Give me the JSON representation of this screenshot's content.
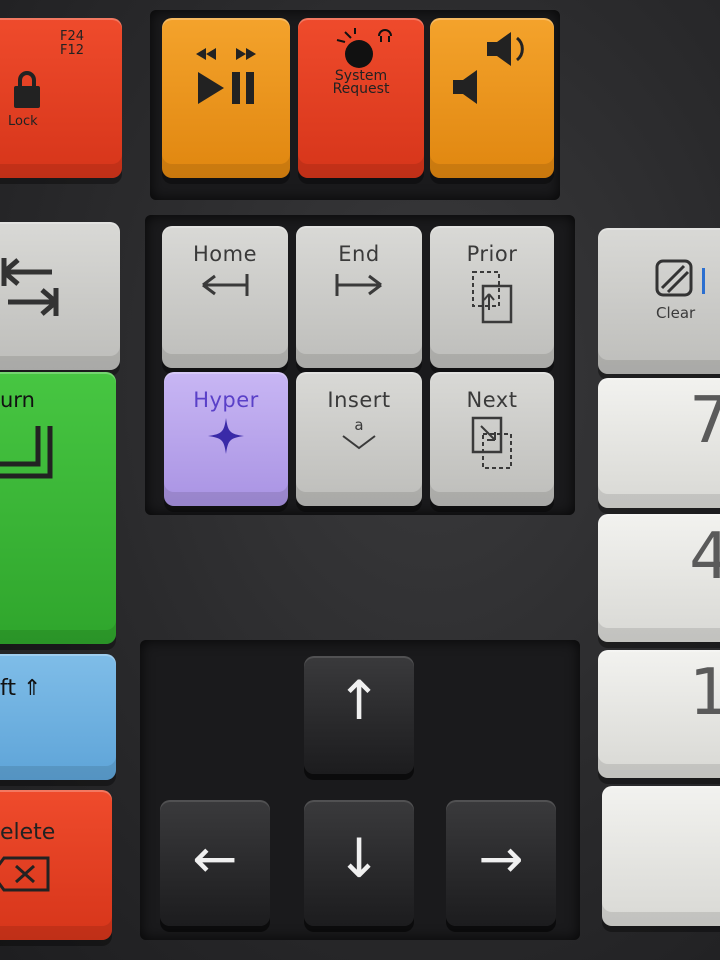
{
  "keys": {
    "lock": {
      "f_top": "F24",
      "f_bottom": "F12",
      "label": "Lock"
    },
    "media_play": {
      "icon": "play-pause-icon"
    },
    "system_request": {
      "line1": "System",
      "line2": "Request"
    },
    "volume": {
      "icon": "volume-icon"
    },
    "tab": {
      "icon": "tab-arrows-icon"
    },
    "home": {
      "label": "Home",
      "icon": "arrow-left-bar-icon"
    },
    "end": {
      "label": "End",
      "icon": "arrow-right-bar-icon"
    },
    "prior": {
      "label": "Prior",
      "icon": "page-up-icon"
    },
    "clear": {
      "label": "Clear"
    },
    "return": {
      "label": "urn"
    },
    "hyper": {
      "label": "Hyper",
      "icon": "sparkle-icon"
    },
    "insert": {
      "label": "Insert",
      "sub": "a"
    },
    "next": {
      "label": "Next",
      "icon": "page-down-icon"
    },
    "seven": {
      "label": "7"
    },
    "four": {
      "label": "4"
    },
    "one": {
      "label": "1"
    },
    "shift": {
      "label": "ft ⇑"
    },
    "delete": {
      "label": "elete"
    },
    "up": {
      "glyph": "↑"
    },
    "left": {
      "glyph": "←"
    },
    "down": {
      "glyph": "↓"
    },
    "right": {
      "glyph": "→"
    }
  },
  "colors": {
    "orange": "#f4a32c",
    "red": "#ef4b2c",
    "green": "#47c642",
    "blue": "#7fbde8",
    "lilac": "#c8b6f4",
    "gray": "#d9d9d6",
    "black": "#2a2a2c"
  }
}
